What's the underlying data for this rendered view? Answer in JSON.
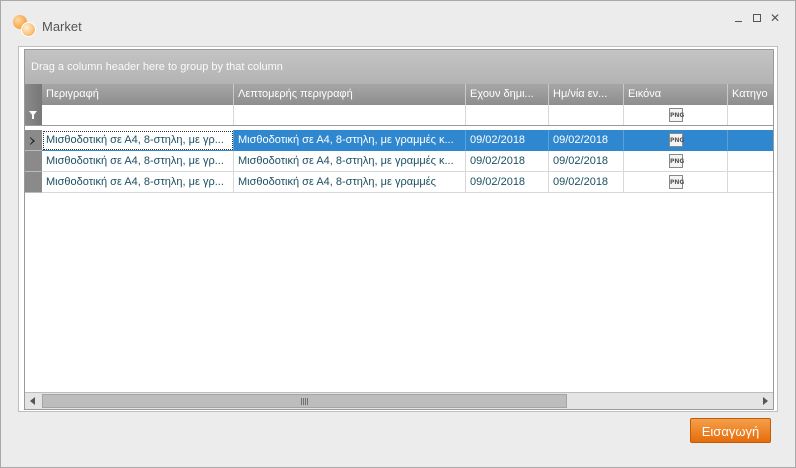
{
  "window": {
    "title": "Market",
    "icon": "market-logo-icon",
    "controls": [
      "minimize-icon",
      "maximize-icon",
      "close-icon"
    ]
  },
  "grid": {
    "group_panel_text": "Drag a column header here to group by that column",
    "columns": [
      "Περιγραφή",
      "Λεπτομερής περιγραφή",
      "Εχουν δημι...",
      "Ημ/νία εν...",
      "Εικόνα",
      "Κατηγο"
    ],
    "filter_icon": "filter-funnel-icon",
    "rows": [
      {
        "description": "Μισθοδοτική σε Α4, 8-στηλη, με γρ...",
        "detailed_description": "Μισθοδοτική σε Α4, 8-στηλη, με γραμμές κ...",
        "created": "09/02/2018",
        "date": "09/02/2018",
        "image": "PNG",
        "category": "",
        "selected": true
      },
      {
        "description": "Μισθοδοτική σε Α4, 8-στηλη, με γρ...",
        "detailed_description": "Μισθοδοτική σε Α4, 8-στηλη, με γραμμές κ...",
        "created": "09/02/2018",
        "date": "09/02/2018",
        "image": "PNG",
        "category": "",
        "selected": false
      },
      {
        "description": "Μισθοδοτική σε Α4, 8-στηλη, με γρ...",
        "detailed_description": "Μισθοδοτική σε Α4, 8-στηλη, με γραμμές",
        "created": "09/02/2018",
        "date": "09/02/2018",
        "image": "PNG",
        "category": "",
        "selected": false
      }
    ]
  },
  "footer": {
    "insert_label": "Εισαγωγή"
  },
  "colors": {
    "selection": "#2f87cf",
    "accent_button": "#e66c0a"
  }
}
